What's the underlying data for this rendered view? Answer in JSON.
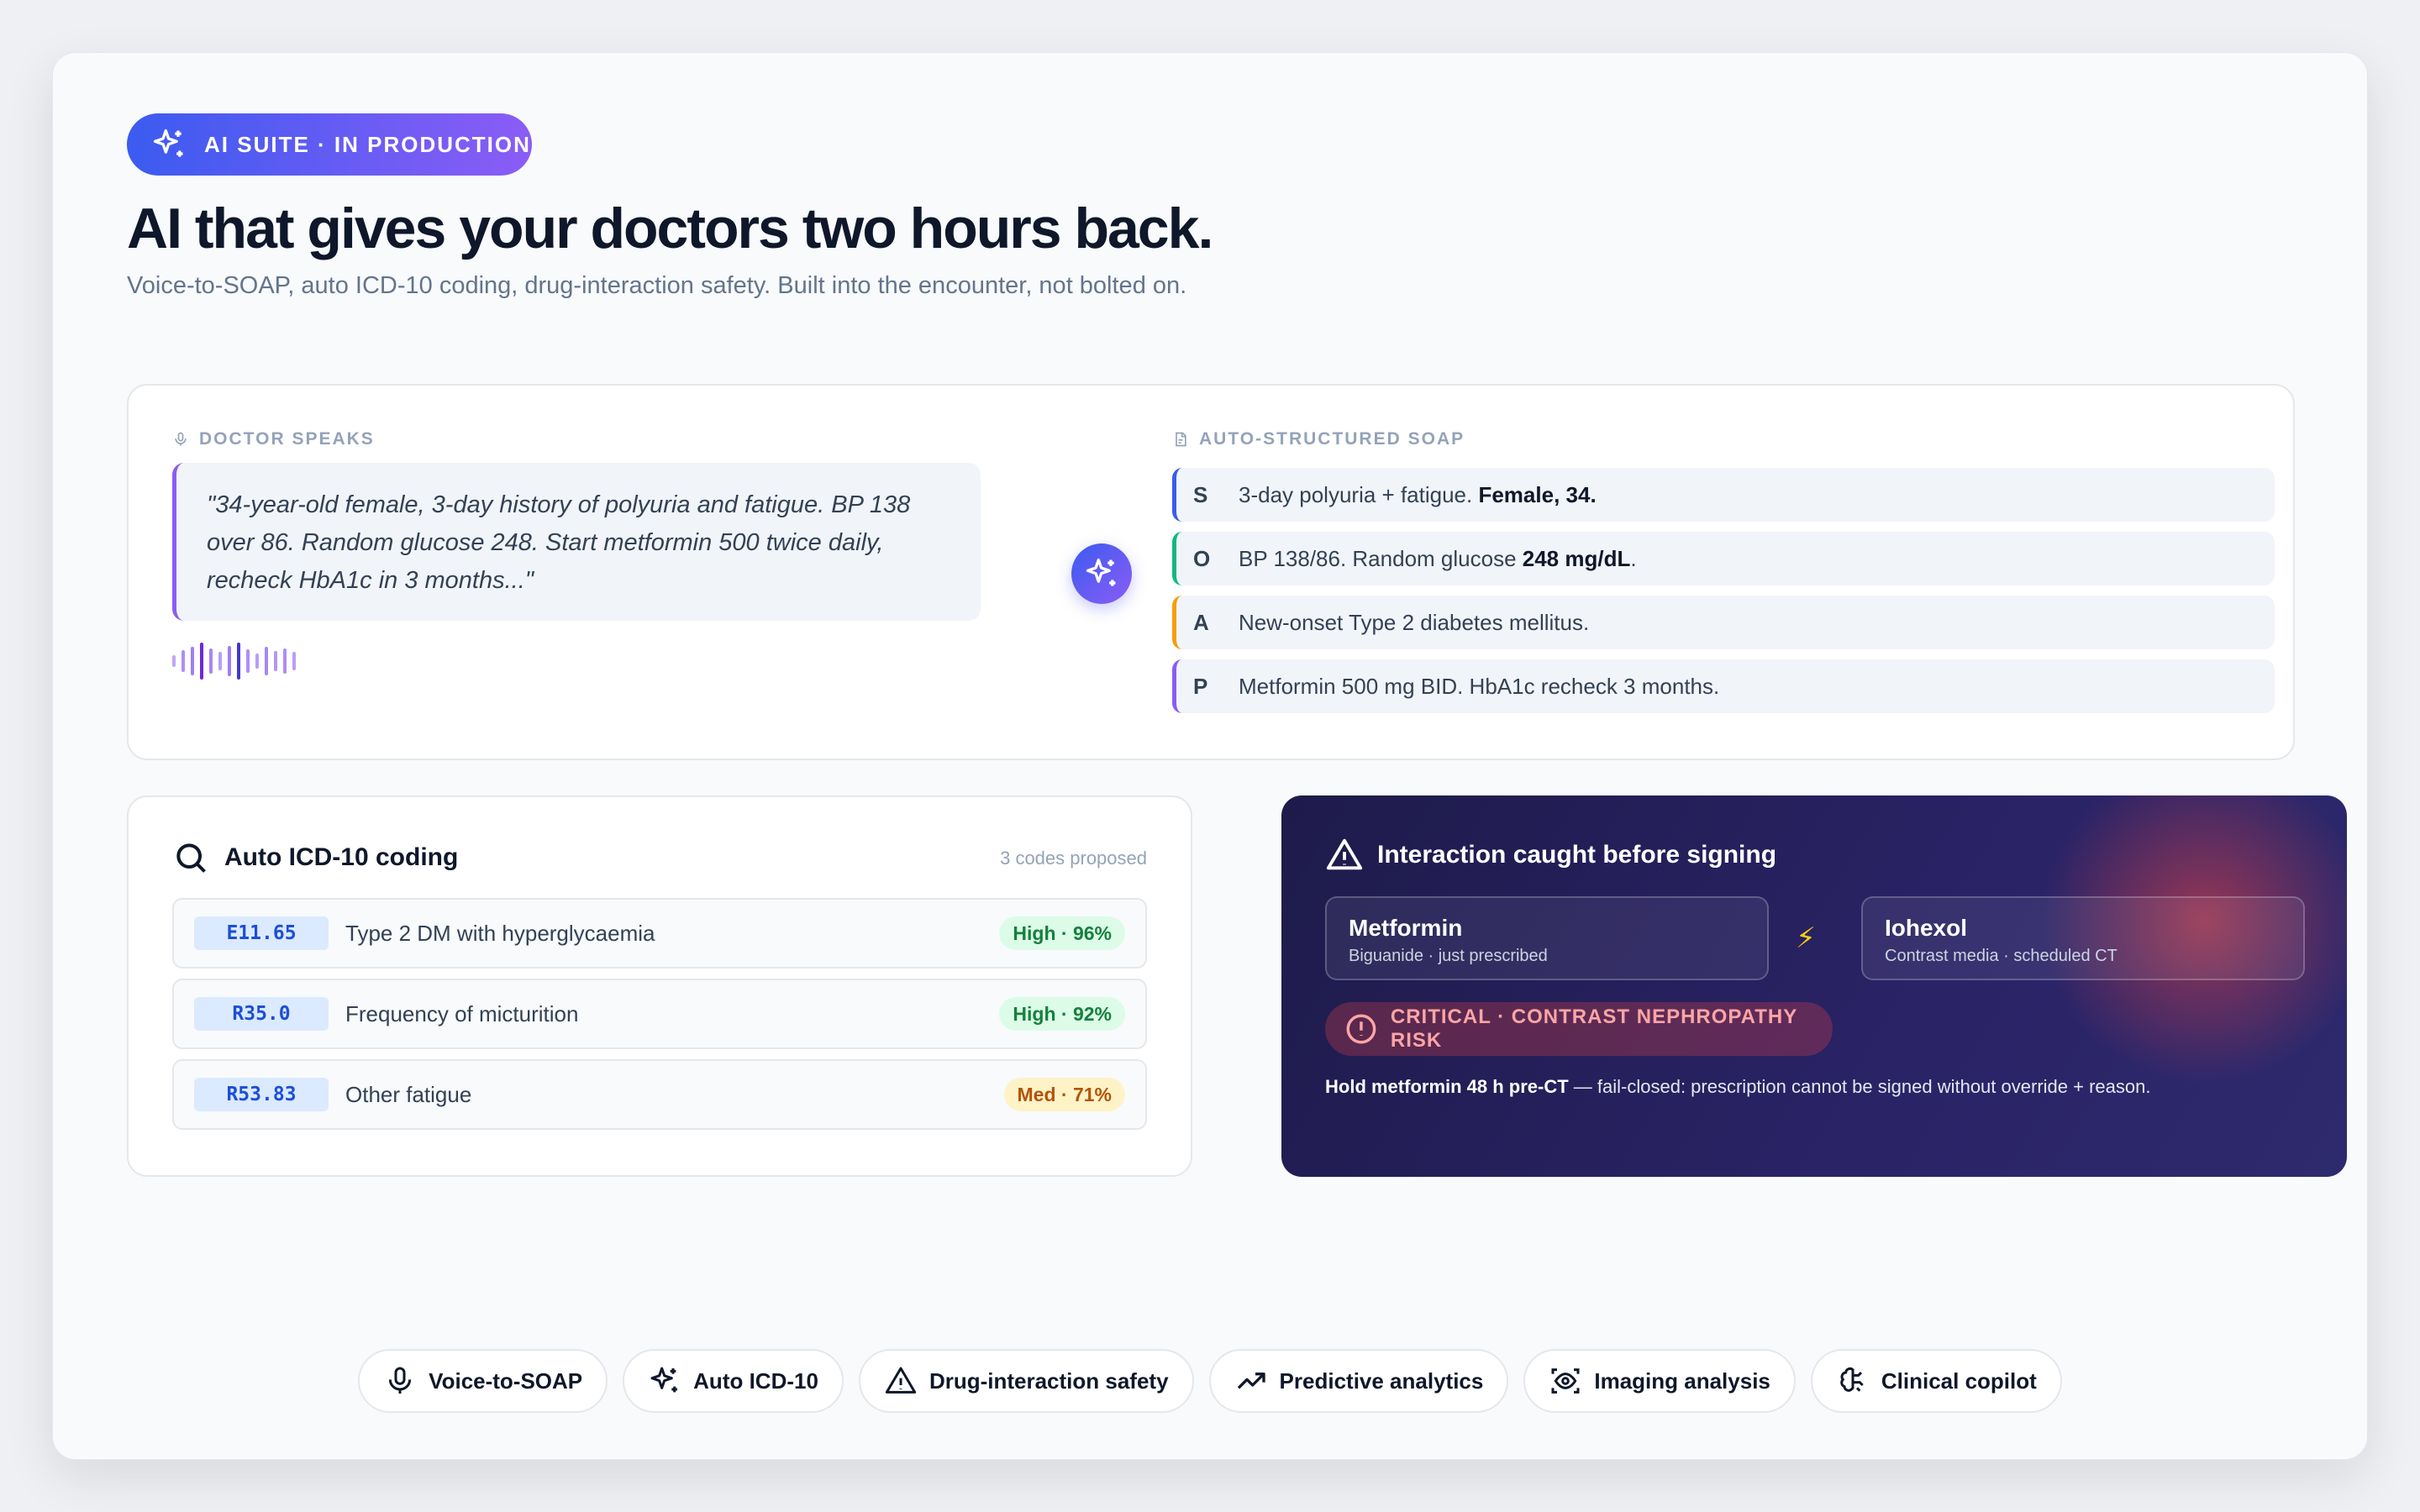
{
  "badge": {
    "label": "AI SUITE · IN PRODUCTION",
    "icon": "sparkles-icon"
  },
  "hero": {
    "title": "AI that gives your doctors two hours back.",
    "subtitle": "Voice-to-SOAP, auto ICD-10 coding, drug-interaction safety. Built into the encounter, not bolted on."
  },
  "dictation": {
    "label": "DOCTOR SPEAKS",
    "quote": "\"34-year-old female, 3-day history of polyuria and fatigue. BP 138 over 86. Random glucose 248. Start metformin 500 twice daily, recheck HbA1c in 3 months...\""
  },
  "soap": {
    "label": "AUTO-STRUCTURED SOAP",
    "rows": [
      {
        "key": "S",
        "text": "3-day polyuria + fatigue. ",
        "bold": "Female, 34.",
        "tail": "",
        "color": "#3b5bf0"
      },
      {
        "key": "O",
        "text": "BP 138/86. Random glucose ",
        "bold": "248 mg/dL",
        "tail": ".",
        "color": "#10b981"
      },
      {
        "key": "A",
        "text": "New-onset Type 2 diabetes mellitus.",
        "bold": "",
        "tail": "",
        "color": "#f59e0b"
      },
      {
        "key": "P",
        "text": "Metformin 500 mg BID. HbA1c recheck 3 months.",
        "bold": "",
        "tail": "",
        "color": "#8b5cf6"
      }
    ]
  },
  "icd": {
    "title": "Auto ICD-10 coding",
    "count": "3 codes proposed",
    "rows": [
      {
        "code": "E11.65",
        "desc": "Type 2 DM with hyperglycaemia",
        "confidence": "High · 96%",
        "level": "high"
      },
      {
        "code": "R35.0",
        "desc": "Frequency of micturition",
        "confidence": "High · 92%",
        "level": "high"
      },
      {
        "code": "R53.83",
        "desc": "Other fatigue",
        "confidence": "Med · 71%",
        "level": "med"
      }
    ]
  },
  "interaction": {
    "title": "Interaction caught before signing",
    "drug_a": {
      "name": "Metformin",
      "detail": "Biguanide · just prescribed"
    },
    "drug_b": {
      "name": "Iohexol",
      "detail": "Contrast media · scheduled CT"
    },
    "bolt": "⚡",
    "severity": "CRITICAL · CONTRAST NEPHROPATHY RISK",
    "note_bold": "Hold metformin 48 h pre-CT",
    "note": " — fail-closed: prescription cannot be signed without override + reason."
  },
  "features": [
    {
      "label": "Voice-to-SOAP",
      "icon": "microphone-icon"
    },
    {
      "label": "Auto ICD-10",
      "icon": "sparkles-icon"
    },
    {
      "label": "Drug-interaction safety",
      "icon": "warning-icon"
    },
    {
      "label": "Predictive analytics",
      "icon": "trending-up-icon"
    },
    {
      "label": "Imaging analysis",
      "icon": "scan-eye-icon"
    },
    {
      "label": "Clinical copilot",
      "icon": "brain-icon"
    }
  ],
  "colors": {
    "accent": "#3b5bf0",
    "accent2": "#8b5cf6",
    "alert_bg": "#1e1b4b",
    "critical": "#fca5a5"
  }
}
